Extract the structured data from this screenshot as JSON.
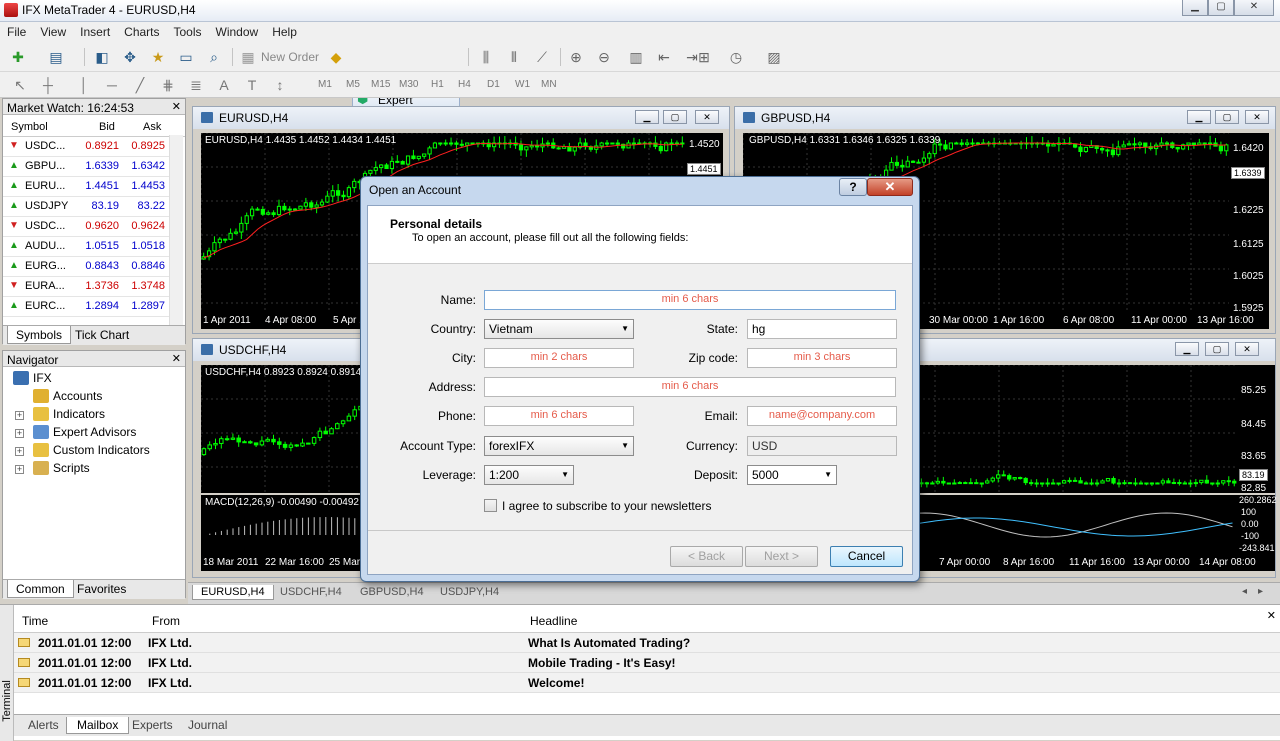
{
  "app": {
    "title": "IFX MetaTrader 4 - EURUSD,H4"
  },
  "menu": [
    "File",
    "View",
    "Insert",
    "Charts",
    "Tools",
    "Window",
    "Help"
  ],
  "toolbar": {
    "new_order": "New Order",
    "expert_advisors": "Expert Advisors",
    "timeframes": [
      "M1",
      "M5",
      "M15",
      "M30",
      "H1",
      "H4",
      "D1",
      "W1",
      "MN"
    ]
  },
  "market_watch": {
    "title": "Market Watch: 16:24:53",
    "columns": [
      "Symbol",
      "Bid",
      "Ask"
    ],
    "rows": [
      {
        "symbol": "USDC...",
        "bid": "0.8921",
        "ask": "0.8925",
        "dir": "down"
      },
      {
        "symbol": "GBPU...",
        "bid": "1.6339",
        "ask": "1.6342",
        "dir": "up"
      },
      {
        "symbol": "EURU...",
        "bid": "1.4451",
        "ask": "1.4453",
        "dir": "up"
      },
      {
        "symbol": "USDJPY",
        "bid": "83.19",
        "ask": "83.22",
        "dir": "up"
      },
      {
        "symbol": "USDC...",
        "bid": "0.9620",
        "ask": "0.9624",
        "dir": "down"
      },
      {
        "symbol": "AUDU...",
        "bid": "1.0515",
        "ask": "1.0518",
        "dir": "up"
      },
      {
        "symbol": "EURG...",
        "bid": "0.8843",
        "ask": "0.8846",
        "dir": "up"
      },
      {
        "symbol": "EURA...",
        "bid": "1.3736",
        "ask": "1.3748",
        "dir": "down"
      },
      {
        "symbol": "EURC...",
        "bid": "1.2894",
        "ask": "1.2897",
        "dir": "up"
      }
    ],
    "tabs": [
      "Symbols",
      "Tick Chart"
    ]
  },
  "navigator": {
    "title": "Navigator",
    "root": "IFX",
    "items": [
      "Accounts",
      "Indicators",
      "Expert Advisors",
      "Custom Indicators",
      "Scripts"
    ],
    "tabs": [
      "Common",
      "Favorites"
    ]
  },
  "charts": {
    "eurusd": {
      "title": "EURUSD,H4",
      "info": "EURUSD,H4  1.4435 1.4452 1.4434 1.4451",
      "price_top": "1.4520",
      "price_tag": "1.4451",
      "dates": [
        "1 Apr 2011",
        "4 Apr 08:00",
        "5 Apr 1"
      ]
    },
    "gbpusd": {
      "title": "GBPUSD,H4",
      "info": "GBPUSD,H4  1.6331 1.6346 1.6325 1.6339",
      "prices": [
        "1.6420",
        "1.6339",
        "1.6225",
        "1.6125",
        "1.6025",
        "1.5925"
      ],
      "dates": [
        "30 Mar 00:00",
        "1 Apr 16:00",
        "6 Apr 08:00",
        "11 Apr 00:00",
        "13 Apr 16:00"
      ]
    },
    "usdchf": {
      "title": "USDCHF,H4",
      "info": "USDCHF,H4  0.8923 0.8924 0.8914",
      "macd": "MACD(12,26,9) -0.00490 -0.00492",
      "dates": [
        "18 Mar 2011",
        "22 Mar 16:00",
        "25 Mar"
      ]
    },
    "usdjpy": {
      "prices": [
        "85.25",
        "84.45",
        "83.65",
        "83.19",
        "82.85"
      ],
      "macd_scale": [
        "260.2862",
        "100",
        "0.00",
        "-100",
        "-243.841"
      ],
      "dates": [
        "7 Apr 00:00",
        "8 Apr 16:00",
        "11 Apr 16:00",
        "13 Apr 00:00",
        "14 Apr 08:00"
      ]
    }
  },
  "chart_tabs": [
    "EURUSD,H4",
    "USDCHF,H4",
    "GBPUSD,H4",
    "USDJPY,H4"
  ],
  "terminal": {
    "side_label": "Terminal",
    "columns": [
      "Time",
      "From",
      "Headline"
    ],
    "rows": [
      {
        "time": "2011.01.01 12:00",
        "from": "IFX Ltd.",
        "headline": "What Is Automated Trading?"
      },
      {
        "time": "2011.01.01 12:00",
        "from": "IFX Ltd.",
        "headline": "Mobile Trading - It's Easy!"
      },
      {
        "time": "2011.01.01 12:00",
        "from": "IFX Ltd.",
        "headline": "Welcome!"
      }
    ],
    "tabs": [
      "Alerts",
      "Mailbox",
      "Experts",
      "Journal"
    ]
  },
  "dialog": {
    "title": "Open an Account",
    "heading": "Personal details",
    "subheading": "To open an account, please fill out all the following fields:",
    "labels": {
      "name": "Name:",
      "country": "Country:",
      "state": "State:",
      "city": "City:",
      "zip": "Zip code:",
      "address": "Address:",
      "phone": "Phone:",
      "email": "Email:",
      "account_type": "Account Type:",
      "currency": "Currency:",
      "leverage": "Leverage:",
      "deposit": "Deposit:"
    },
    "placeholders": {
      "name": "min 6 chars",
      "city": "min 2 chars",
      "zip": "min 3 chars",
      "address": "min 6 chars",
      "phone": "min 6 chars",
      "email": "name@company.com"
    },
    "values": {
      "country": "Vietnam",
      "state": "hg",
      "account_type": "forexIFX",
      "currency": "USD",
      "leverage": "1:200",
      "deposit": "5000"
    },
    "newsletter": "I agree to subscribe to your newsletters",
    "buttons": {
      "back": "< Back",
      "next": "Next >",
      "cancel": "Cancel"
    }
  }
}
